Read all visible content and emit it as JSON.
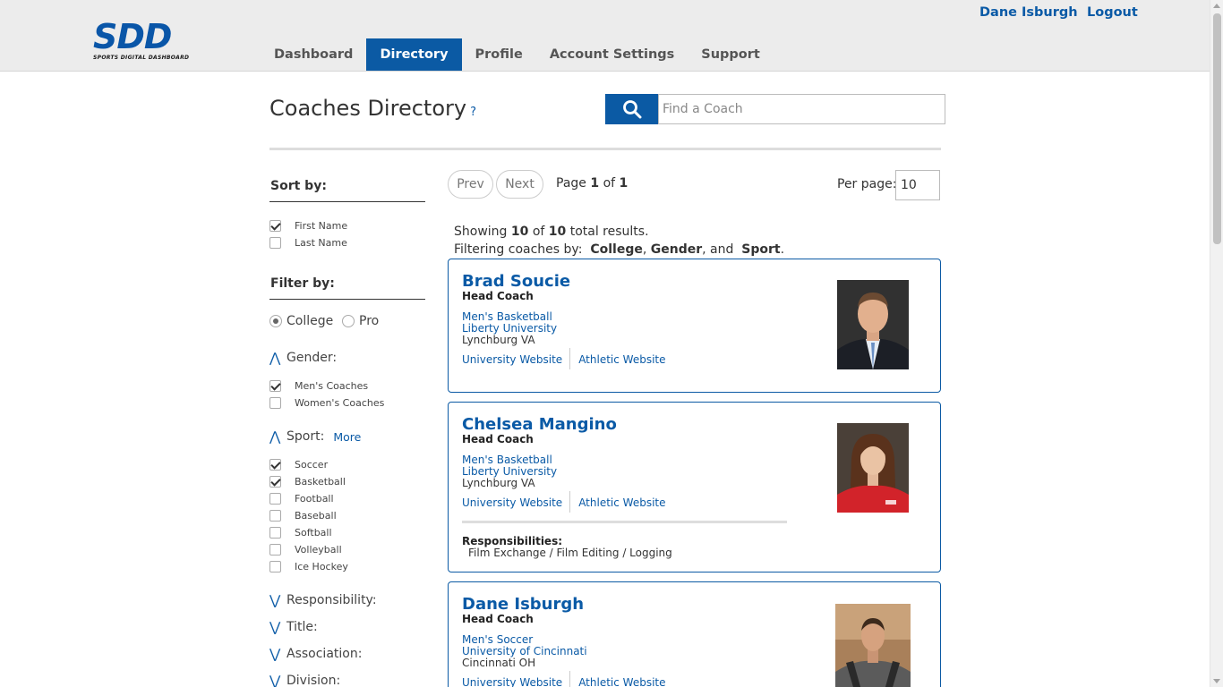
{
  "brand": {
    "logo_text": "SDD",
    "logo_subtitle": "SPORTS DIGITAL DASHBOARD",
    "accent": "#0b5aa4"
  },
  "nav": {
    "items": [
      {
        "label": "Dashboard"
      },
      {
        "label": "Directory",
        "active": true
      },
      {
        "label": "Profile"
      },
      {
        "label": "Account Settings"
      },
      {
        "label": "Support"
      }
    ]
  },
  "user": {
    "name": "Dane Isburgh",
    "logout": "Logout"
  },
  "page": {
    "title": "Coaches Directory",
    "help": "?"
  },
  "search": {
    "placeholder": "Find a Coach",
    "icon": "search-icon"
  },
  "sidebar": {
    "sort_by": "Sort by:",
    "sort_options": [
      {
        "label": "First Name",
        "checked": true
      },
      {
        "label": "Last Name",
        "checked": false
      }
    ],
    "filter_by": "Filter by:",
    "level_options": [
      {
        "label": "College",
        "selected": true
      },
      {
        "label": "Pro",
        "selected": false
      }
    ],
    "gender_heading": "Gender:",
    "gender_options": [
      {
        "label": "Men's Coaches",
        "checked": true
      },
      {
        "label": "Women's Coaches",
        "checked": false
      }
    ],
    "sport_heading": "Sport:",
    "sport_more": "More",
    "sport_options": [
      {
        "label": "Soccer",
        "checked": true
      },
      {
        "label": "Basketball",
        "checked": true
      },
      {
        "label": "Football",
        "checked": false
      },
      {
        "label": "Baseball",
        "checked": false
      },
      {
        "label": "Softball",
        "checked": false
      },
      {
        "label": "Volleyball",
        "checked": false
      },
      {
        "label": "Ice Hockey",
        "checked": false
      }
    ],
    "collapsed_sections": [
      "Responsibility:",
      "Title:",
      "Association:",
      "Division:"
    ],
    "expanded_chevron": "⋀",
    "collapsed_chevron": "⋁"
  },
  "pagination": {
    "prev": "Prev",
    "next": "Next",
    "page_word": "Page",
    "current": "1",
    "of_word": "of",
    "total": "1",
    "per_page_label": "Per page:",
    "per_page_value": "10"
  },
  "summary": {
    "showing": "Showing",
    "count": "10",
    "of_word": "of",
    "total": "10",
    "suffix": "total results.",
    "filter_prefix": "Filtering coaches by:",
    "filter_college": "College",
    "filter_gender": "Gender",
    "filter_and": ", and",
    "filter_sport": "Sport",
    "filter_end": "."
  },
  "coaches": [
    {
      "name": "Brad Soucie",
      "title": "Head Coach",
      "team": "Men's Basketball",
      "school": "Liberty University",
      "location": "Lynchburg VA",
      "university_link": "University Website",
      "athletic_link": "Athletic Website",
      "responsibilities_label": "",
      "responsibilities": ""
    },
    {
      "name": "Chelsea Mangino",
      "title": "Head Coach",
      "team": "Men's Basketball",
      "school": "Liberty University",
      "location": "Lynchburg VA",
      "university_link": "University Website",
      "athletic_link": "Athletic Website",
      "responsibilities_label": "Responsibilities:",
      "responsibilities": "Film Exchange / Film Editing / Logging"
    },
    {
      "name": "Dane Isburgh",
      "title": "Head Coach",
      "team": "Men's Soccer",
      "school": "University of Cincinnati",
      "location": "Cincinnati OH",
      "university_link": "University Website",
      "athletic_link": "Athletic Website",
      "responsibilities_label": "",
      "responsibilities": ""
    }
  ]
}
